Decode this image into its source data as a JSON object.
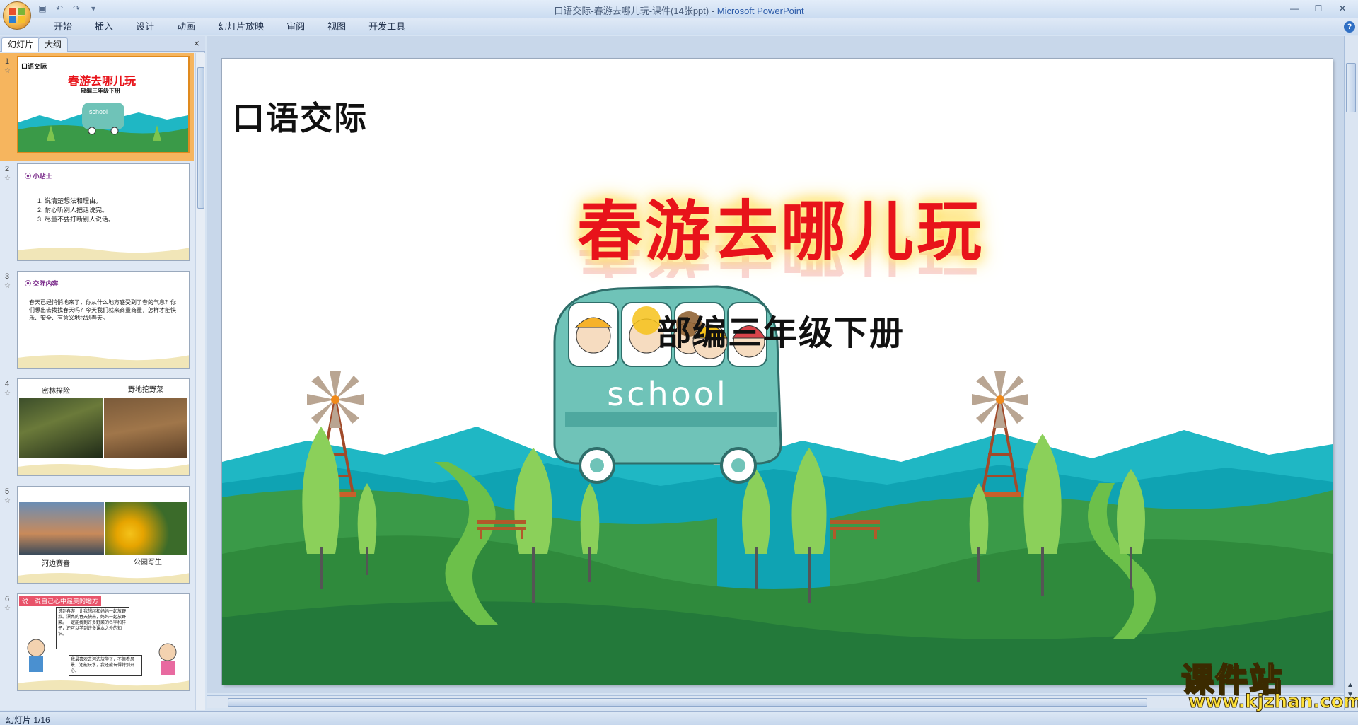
{
  "window": {
    "title_doc": "口语交际-春游去哪儿玩-课件(14张ppt)",
    "title_sep": " - ",
    "title_app": "Microsoft PowerPoint"
  },
  "ribbon": {
    "tabs": [
      "开始",
      "插入",
      "设计",
      "动画",
      "幻灯片放映",
      "审阅",
      "视图",
      "开发工具"
    ]
  },
  "panel": {
    "tab_slides": "幻灯片",
    "tab_outline": "大纲",
    "close": "×"
  },
  "thumbnails": [
    {
      "num": "1",
      "heading": "口语交际",
      "title": "春游去哪儿玩",
      "sub": "部编三年级下册",
      "bus": "school"
    },
    {
      "num": "2",
      "heading": "小贴士",
      "lines": [
        "1. 说清楚想法和理由。",
        "2. 耐心听别人把话说完。",
        "3. 尽量不要打断别人说话。"
      ]
    },
    {
      "num": "3",
      "heading": "交际内容",
      "body": "春天已经悄悄地来了，你从什么地方感受到了春的气息？你们想出去找找春天吗？今天我们就来商量商量，怎样才能快乐、安全、有意义地找到春天。"
    },
    {
      "num": "4",
      "captions": [
        "密林探险",
        "野地挖野菜"
      ]
    },
    {
      "num": "5",
      "captions": [
        "河边赛春",
        "公园写生"
      ]
    },
    {
      "num": "6",
      "banner": "说一说自己心中最美的地方",
      "bubble1": "说到春游，让我想起和妈妈一起放野菜。漂亮的春天快来，妈妈一起放野菜。一定能找到许多野菜的名字和样子，还可以学到许多课本之外的知识。",
      "bubble2": "我最喜欢去河边放学了，不但看风景，还能玩水，我还能玩得特别开心。"
    }
  ],
  "slide": {
    "heading": "口语交际",
    "title": "春游去哪儿玩",
    "subtitle": "部编三年级下册",
    "bus_text": "school"
  },
  "status": {
    "slide_info": "幻灯片 1/16"
  },
  "watermark": {
    "title": "课件站",
    "url": "www.kjzhan.com"
  },
  "colors": {
    "title_red": "#e8131a",
    "grass_dark": "#2f8a3c",
    "grass_light": "#6cc04a",
    "mountain": "#1fb7c4",
    "bus": "#6fc3b8",
    "selection": "#f6b55e"
  }
}
